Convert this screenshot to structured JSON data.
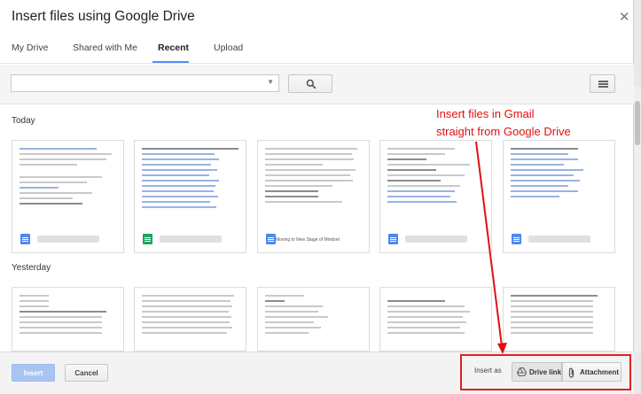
{
  "dialog": {
    "title": "Insert files using Google Drive",
    "close_icon": "close-icon"
  },
  "tabs": [
    {
      "label": "My Drive"
    },
    {
      "label": "Shared with Me"
    },
    {
      "label": "Recent",
      "active": true
    },
    {
      "label": "Upload"
    }
  ],
  "toolbar": {
    "search_value": "",
    "search_icon": "search-icon",
    "list_view_icon": "list-view-icon"
  },
  "sections": [
    {
      "label": "Today"
    },
    {
      "label": "Yesterday"
    }
  ],
  "files_today": [
    {
      "type": "doc"
    },
    {
      "type": "sheet"
    },
    {
      "type": "doc",
      "name": "Moving to New Stage of Mindset"
    },
    {
      "type": "doc"
    },
    {
      "type": "doc"
    }
  ],
  "files_yesterday": [
    {
      "type": "sheet"
    },
    {
      "type": "doc"
    },
    {
      "type": "doc"
    },
    {
      "type": "doc"
    },
    {
      "type": "sheet"
    }
  ],
  "footer": {
    "insert_label": "Insert",
    "cancel_label": "Cancel",
    "insert_as_label": "Insert as",
    "drive_link_label": "Drive link",
    "attachment_label": "Attachment"
  },
  "annotation": {
    "line1": "Insert files in Gmail",
    "line2": "straight from Google Drive",
    "color": "#e01010"
  },
  "colors": {
    "accent": "#4d90fe",
    "insert_disabled": "#a8c5f2",
    "doc_icon": "#4f88f0",
    "sheet_icon": "#1ea362"
  }
}
